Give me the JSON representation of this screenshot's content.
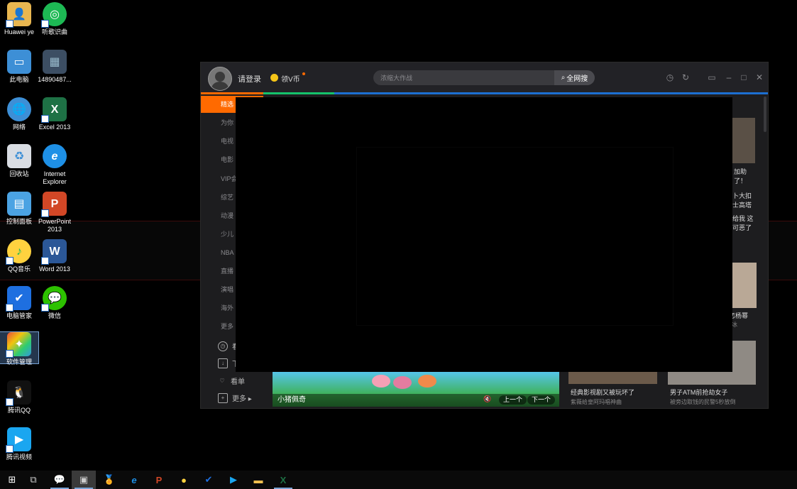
{
  "desktop": {
    "icons": [
      {
        "label": "Huawei ye",
        "icon": "folder-user-icon"
      },
      {
        "label": "听歌识曲",
        "icon": "music-recognition-icon"
      },
      {
        "label": "此电脑",
        "icon": "computer-icon"
      },
      {
        "label": "14890487...",
        "icon": "image-file-icon"
      },
      {
        "label": "网络",
        "icon": "network-icon"
      },
      {
        "label": "Excel 2013",
        "icon": "excel-icon"
      },
      {
        "label": "回收站",
        "icon": "recycle-bin-icon"
      },
      {
        "label": "Internet Explorer",
        "icon": "ie-icon"
      },
      {
        "label": "控制面板",
        "icon": "control-panel-icon"
      },
      {
        "label": "PowerPoint 2013",
        "icon": "powerpoint-icon"
      },
      {
        "label": "QQ音乐",
        "icon": "qq-music-icon"
      },
      {
        "label": "Word 2013",
        "icon": "word-icon"
      },
      {
        "label": "电脑管家",
        "icon": "pc-manager-icon"
      },
      {
        "label": "微信",
        "icon": "wechat-icon"
      },
      {
        "label": "软件管理",
        "icon": "software-manager-icon"
      },
      {
        "label": "腾讯QQ",
        "icon": "qq-icon"
      },
      {
        "label": "腾讯视频",
        "icon": "tencent-video-icon"
      }
    ]
  },
  "app": {
    "login_label": "请登录",
    "vcoin_label": "领V币",
    "search_placeholder": "浓缩大作战",
    "search_button": "全网搜",
    "accent": "#ff6a00",
    "sidebar": {
      "nav": [
        "精选",
        "为你",
        "电视",
        "电影",
        "VIP会",
        "综艺",
        "动漫",
        "少儿",
        "NBA",
        "直播",
        "演唱",
        "海外",
        "更多"
      ],
      "bottom": [
        {
          "label": "看",
          "icon": "history-icon"
        },
        {
          "label": "下",
          "icon": "download-icon"
        },
        {
          "label": "看单",
          "icon": "heart-list-icon"
        },
        {
          "label": "更多 ▸",
          "icon": "add-icon"
        }
      ]
    },
    "right_column": {
      "fragments": [
        "加助",
        "了！",
        "卜大扣",
        "士高塔",
        "给我 这",
        "可恶了",
        "恋杨幂",
        "冰"
      ]
    },
    "banner": {
      "title": "小猪佩奇",
      "prev": "上一个",
      "next": "下一个"
    },
    "cards": [
      {
        "title": "经典影视剧又被玩坏了",
        "sub": "紫薇给皇阿玛唱神曲"
      },
      {
        "title": "男子ATM前抢劫女子",
        "sub": "被旁边取钱的民警5秒放倒"
      }
    ]
  },
  "taskbar": {
    "items": [
      "start-icon",
      "task-view-icon",
      "wechat-icon",
      "media-icon",
      "medal-icon",
      "ie-icon",
      "powerpoint-icon",
      "qq-music-icon",
      "pc-manager-icon",
      "tencent-video-icon",
      "file-explorer-icon",
      "excel-icon"
    ]
  }
}
